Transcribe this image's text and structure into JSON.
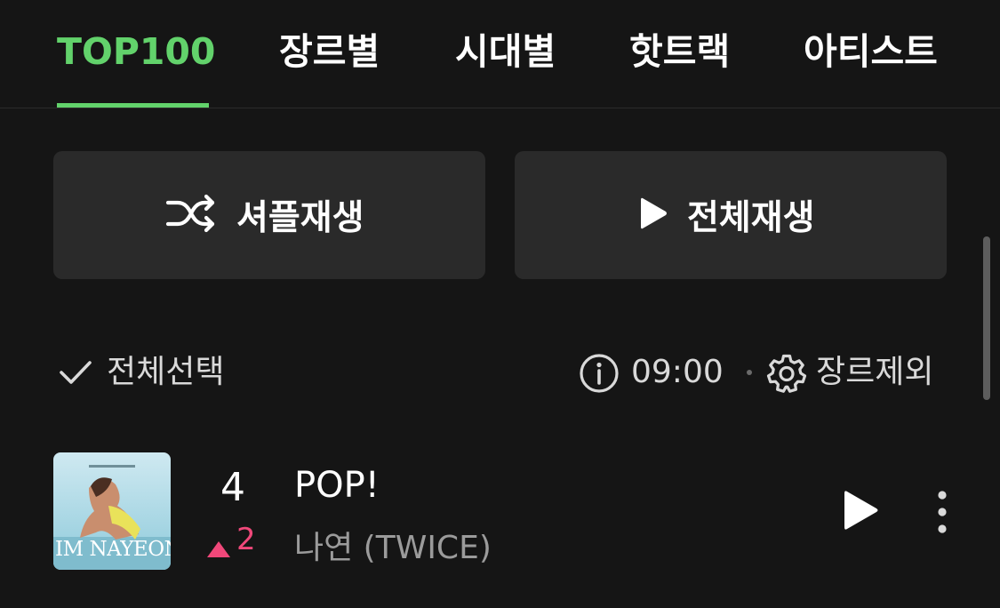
{
  "tabs": [
    {
      "label": "TOP100",
      "active": true
    },
    {
      "label": "장르별",
      "active": false
    },
    {
      "label": "시대별",
      "active": false
    },
    {
      "label": "핫트랙",
      "active": false
    },
    {
      "label": "아티스트",
      "active": false
    }
  ],
  "actions": {
    "shuffle_label": "셔플재생",
    "shuffle_icon": "shuffle-icon",
    "play_all_label": "전체재생",
    "play_all_icon": "play-icon"
  },
  "toolbar": {
    "select_all_label": "전체선택",
    "select_all_icon": "checkmark-icon",
    "info_icon": "info-icon",
    "update_time": "09:00",
    "genre_exclude_label": "장르제외",
    "genre_exclude_icon": "gear-icon"
  },
  "tracks": [
    {
      "rank": "4",
      "change_direction": "up",
      "change_amount": "2",
      "title": "POP!",
      "artist": "나연 (TWICE)",
      "album_art_text": "IM NAYEON"
    }
  ],
  "colors": {
    "accent": "#62d26b",
    "background": "#151515",
    "button_bg": "#2a2a2a",
    "rank_up": "#f0487a"
  }
}
